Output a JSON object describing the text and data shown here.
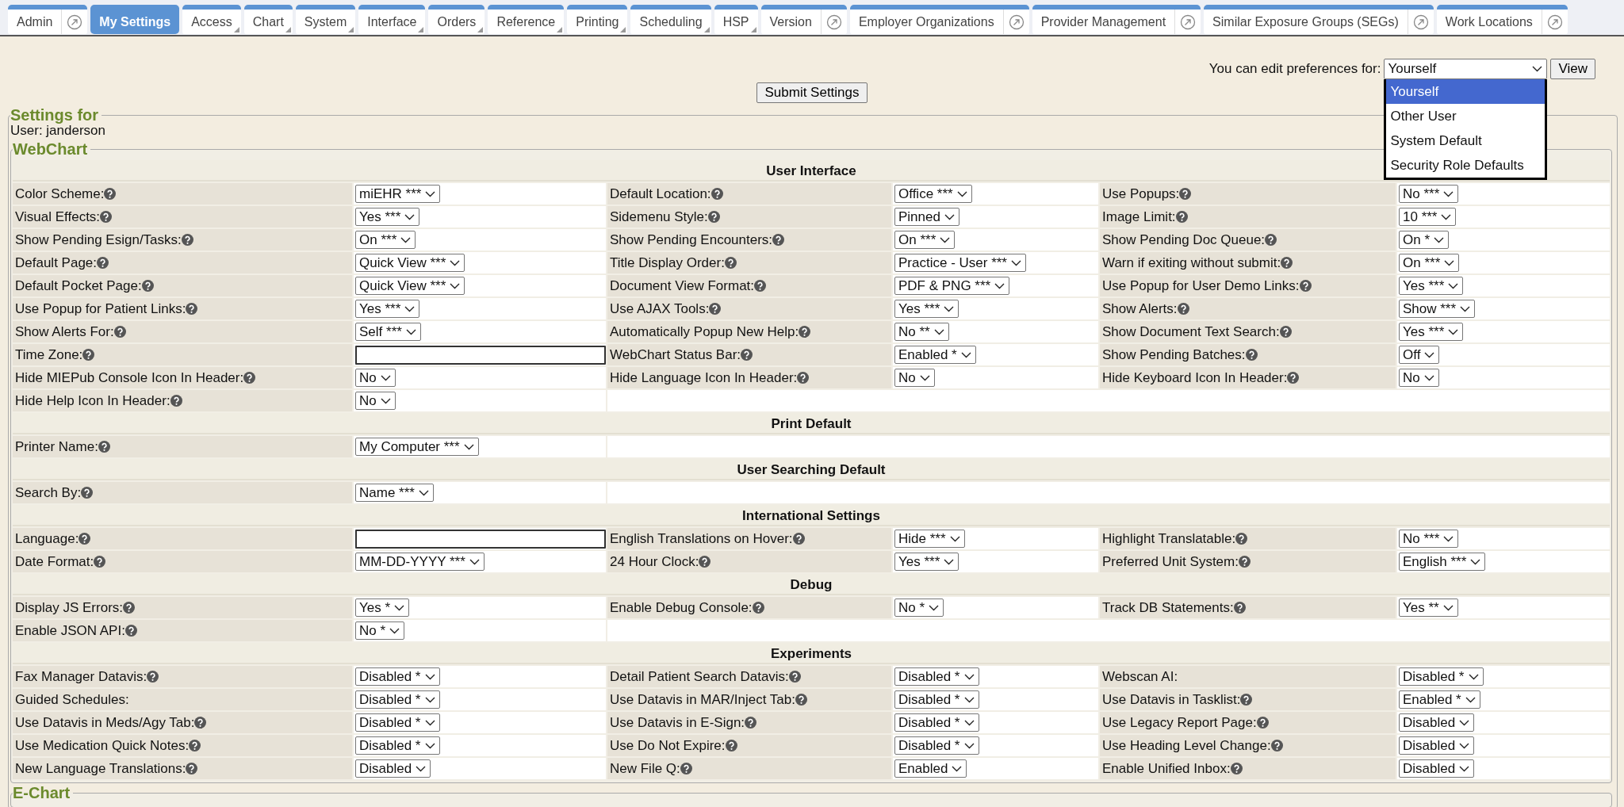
{
  "tabs": [
    {
      "label": "Admin",
      "kind": "popout",
      "selected": false
    },
    {
      "label": "My Settings",
      "kind": "plain",
      "selected": true
    },
    {
      "label": "Access",
      "kind": "menu",
      "selected": false
    },
    {
      "label": "Chart",
      "kind": "menu",
      "selected": false
    },
    {
      "label": "System",
      "kind": "menu",
      "selected": false
    },
    {
      "label": "Interface",
      "kind": "menu",
      "selected": false
    },
    {
      "label": "Orders",
      "kind": "menu",
      "selected": false
    },
    {
      "label": "Reference",
      "kind": "menu",
      "selected": false
    },
    {
      "label": "Printing",
      "kind": "menu",
      "selected": false
    },
    {
      "label": "Scheduling",
      "kind": "menu",
      "selected": false
    },
    {
      "label": "HSP",
      "kind": "menu",
      "selected": false
    },
    {
      "label": "Version",
      "kind": "popout",
      "selected": false
    },
    {
      "label": "Employer Organizations",
      "kind": "popout",
      "selected": false
    },
    {
      "label": "Provider Management",
      "kind": "popout",
      "selected": false
    },
    {
      "label": "Similar Exposure Groups (SEGs)",
      "kind": "popout",
      "selected": false
    },
    {
      "label": "Work Locations",
      "kind": "popout",
      "selected": false
    }
  ],
  "preferences": {
    "label": "You can edit preferences for:",
    "value": "Yourself",
    "button": "View",
    "options": [
      {
        "label": "Yourself",
        "selected": true
      },
      {
        "label": "Other User",
        "selected": false
      },
      {
        "label": "System Default",
        "selected": false
      },
      {
        "label": "Security Role Defaults",
        "selected": false
      }
    ]
  },
  "submit_button": "Submit Settings",
  "settings": {
    "legend": "Settings for",
    "user": "User: janderson",
    "groups": [
      {
        "legend": "WebChart",
        "sections": [
          {
            "title": "User Interface",
            "rows": [
              [
                {
                  "label": "Color Scheme:",
                  "help": true,
                  "kind": "select",
                  "value": "miEHR ***"
                },
                {
                  "label": "Default Location:",
                  "help": true,
                  "kind": "select",
                  "value": "Office ***"
                },
                {
                  "label": "Use Popups:",
                  "help": true,
                  "kind": "select",
                  "value": "No ***"
                }
              ],
              [
                {
                  "label": "Visual Effects:",
                  "help": true,
                  "kind": "select",
                  "value": "Yes ***"
                },
                {
                  "label": "Sidemenu Style:",
                  "help": true,
                  "kind": "select",
                  "value": "Pinned"
                },
                {
                  "label": "Image Limit:",
                  "help": true,
                  "kind": "select",
                  "value": "10 ***"
                }
              ],
              [
                {
                  "label": "Show Pending Esign/Tasks:",
                  "help": true,
                  "kind": "select",
                  "value": "On ***"
                },
                {
                  "label": "Show Pending Encounters:",
                  "help": true,
                  "kind": "select",
                  "value": "On ***"
                },
                {
                  "label": "Show Pending Doc Queue:",
                  "help": true,
                  "kind": "select",
                  "value": "On *"
                }
              ],
              [
                {
                  "label": "Default Page:",
                  "help": true,
                  "kind": "select",
                  "value": "Quick View ***"
                },
                {
                  "label": "Title Display Order:",
                  "help": true,
                  "kind": "select",
                  "value": "Practice - User ***"
                },
                {
                  "label": "Warn if exiting without submit:",
                  "help": true,
                  "kind": "select",
                  "value": "On ***"
                }
              ],
              [
                {
                  "label": "Default Pocket Page:",
                  "help": true,
                  "kind": "select",
                  "value": "Quick View ***"
                },
                {
                  "label": "Document View Format:",
                  "help": true,
                  "kind": "select",
                  "value": "PDF & PNG ***"
                },
                {
                  "label": "Use Popup for User Demo Links:",
                  "help": true,
                  "kind": "select",
                  "value": "Yes ***"
                }
              ],
              [
                {
                  "label": "Use Popup for Patient Links:",
                  "help": true,
                  "kind": "select",
                  "value": "Yes ***"
                },
                {
                  "label": "Use AJAX Tools:",
                  "help": true,
                  "kind": "select",
                  "value": "Yes ***"
                },
                {
                  "label": "Show Alerts:",
                  "help": true,
                  "kind": "select",
                  "value": "Show ***"
                }
              ],
              [
                {
                  "label": "Show Alerts For:",
                  "help": true,
                  "kind": "select",
                  "value": "Self ***"
                },
                {
                  "label": "Automatically Popup New Help:",
                  "help": true,
                  "kind": "select",
                  "value": "No **"
                },
                {
                  "label": "Show Document Text Search:",
                  "help": true,
                  "kind": "select",
                  "value": "Yes ***"
                }
              ],
              [
                {
                  "label": "Time Zone:",
                  "help": true,
                  "kind": "text"
                },
                {
                  "label": "WebChart Status Bar:",
                  "help": true,
                  "kind": "select",
                  "value": "Enabled *"
                },
                {
                  "label": "Show Pending Batches:",
                  "help": true,
                  "kind": "select",
                  "value": "Off"
                }
              ],
              [
                {
                  "label": "Hide MIEPub Console Icon In Header:",
                  "help": true,
                  "kind": "select",
                  "value": "No"
                },
                {
                  "label": "Hide Language Icon In Header:",
                  "help": true,
                  "kind": "select",
                  "value": "No"
                },
                {
                  "label": "Hide Keyboard Icon In Header:",
                  "help": true,
                  "kind": "select",
                  "value": "No"
                }
              ],
              [
                {
                  "label": "Hide Help Icon In Header:",
                  "help": true,
                  "kind": "select",
                  "value": "No"
                }
              ]
            ]
          },
          {
            "title": "Print Default",
            "rows": [
              [
                {
                  "label": "Printer Name:",
                  "help": true,
                  "kind": "select",
                  "value": "My Computer ***"
                }
              ]
            ]
          },
          {
            "title": "User Searching Default",
            "rows": [
              [
                {
                  "label": "Search By:",
                  "help": true,
                  "kind": "select",
                  "value": "Name ***"
                }
              ]
            ]
          },
          {
            "title": "International Settings",
            "rows": [
              [
                {
                  "label": "Language:",
                  "help": true,
                  "kind": "text"
                },
                {
                  "label": "English Translations on Hover:",
                  "help": true,
                  "kind": "select",
                  "value": "Hide ***"
                },
                {
                  "label": "Highlight Translatable:",
                  "help": true,
                  "kind": "select",
                  "value": "No ***"
                }
              ],
              [
                {
                  "label": "Date Format:",
                  "help": true,
                  "kind": "select",
                  "value": "MM-DD-YYYY ***"
                },
                {
                  "label": "24 Hour Clock:",
                  "help": true,
                  "kind": "select",
                  "value": "Yes ***"
                },
                {
                  "label": "Preferred Unit System:",
                  "help": true,
                  "kind": "select",
                  "value": "English ***"
                }
              ]
            ]
          },
          {
            "title": "Debug",
            "rows": [
              [
                {
                  "label": "Display JS Errors:",
                  "help": true,
                  "kind": "select",
                  "value": "Yes *"
                },
                {
                  "label": "Enable Debug Console:",
                  "help": true,
                  "kind": "select",
                  "value": "No *"
                },
                {
                  "label": "Track DB Statements:",
                  "help": true,
                  "kind": "select",
                  "value": "Yes **"
                }
              ],
              [
                {
                  "label": "Enable JSON API:",
                  "help": true,
                  "kind": "select",
                  "value": "No *"
                }
              ]
            ]
          },
          {
            "title": "Experiments",
            "rows": [
              [
                {
                  "label": "Fax Manager Datavis:",
                  "help": true,
                  "kind": "select",
                  "value": "Disabled *"
                },
                {
                  "label": "Detail Patient Search Datavis:",
                  "help": true,
                  "kind": "select",
                  "value": "Disabled *"
                },
                {
                  "label": "Webscan AI:",
                  "help": false,
                  "kind": "select",
                  "value": "Disabled *"
                }
              ],
              [
                {
                  "label": "Guided Schedules:",
                  "help": false,
                  "kind": "select",
                  "value": "Disabled *"
                },
                {
                  "label": "Use Datavis in MAR/Inject Tab:",
                  "help": true,
                  "kind": "select",
                  "value": "Disabled *"
                },
                {
                  "label": "Use Datavis in Tasklist:",
                  "help": true,
                  "kind": "select",
                  "value": "Enabled *"
                }
              ],
              [
                {
                  "label": "Use Datavis in Meds/Agy Tab:",
                  "help": true,
                  "kind": "select",
                  "value": "Disabled *"
                },
                {
                  "label": "Use Datavis in E-Sign:",
                  "help": true,
                  "kind": "select",
                  "value": "Disabled *"
                },
                {
                  "label": "Use Legacy Report Page:",
                  "help": true,
                  "kind": "select",
                  "value": "Disabled"
                }
              ],
              [
                {
                  "label": "Use Medication Quick Notes:",
                  "help": true,
                  "kind": "select",
                  "value": "Disabled *"
                },
                {
                  "label": "Use Do Not Expire:",
                  "help": true,
                  "kind": "select",
                  "value": "Disabled *"
                },
                {
                  "label": "Use Heading Level Change:",
                  "help": true,
                  "kind": "select",
                  "value": "Disabled"
                }
              ],
              [
                {
                  "label": "New Language Translations:",
                  "help": true,
                  "kind": "select",
                  "value": "Disabled"
                },
                {
                  "label": "New File Q:",
                  "help": true,
                  "kind": "select",
                  "value": "Enabled"
                },
                {
                  "label": "Enable Unified Inbox:",
                  "help": true,
                  "kind": "select",
                  "value": "Disabled"
                }
              ]
            ]
          }
        ]
      },
      {
        "legend": "E-Chart"
      }
    ]
  }
}
